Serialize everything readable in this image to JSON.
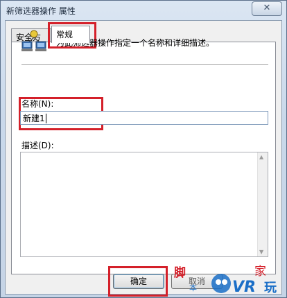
{
  "window": {
    "title": "新筛选器操作 属性",
    "close_glyph": "✕"
  },
  "tabs": [
    {
      "label": "安全方法"
    },
    {
      "label": "常规"
    }
  ],
  "info": {
    "text": "为此筛选器操作指定一个名称和详细描述。",
    "icon": "network-computers-icon"
  },
  "name_field": {
    "label": "名称(N):",
    "value": "新建1"
  },
  "description_field": {
    "label": "描述(D):",
    "value": ""
  },
  "buttons": {
    "ok": "确定",
    "cancel": "取消"
  },
  "watermark": {
    "text": "脚本之家 VR玩"
  },
  "colors": {
    "highlight_box": "#d4202a",
    "accent": "#1a6ec7"
  }
}
